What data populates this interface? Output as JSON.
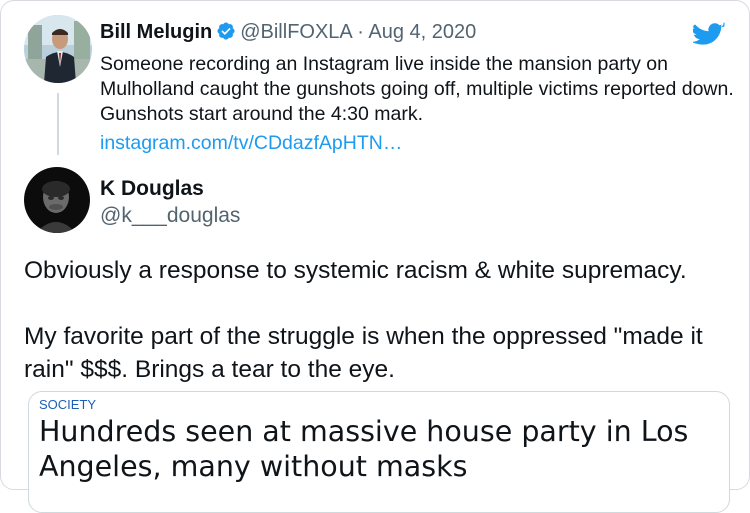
{
  "quoted_tweet": {
    "author_name": "Bill Melugin",
    "handle": "@BillFOXLA",
    "separator": "·",
    "date": "Aug 4, 2020",
    "text": "Someone recording an Instagram live inside the mansion party on Mulholland caught the gunshots going off, multiple victims reported down. Gunshots start around the 4:30 mark.",
    "link": "instagram.com/tv/CDdazfApHTN…",
    "verified_icon": "verified-badge-icon",
    "platform_icon": "twitter-bird-icon"
  },
  "reply": {
    "author_name": "K Douglas",
    "handle": "@k___douglas",
    "text_paragraph_1": "Obviously a response to systemic racism & white supremacy.",
    "text_paragraph_2": "My favorite part of the struggle is when the oppressed \"made it rain\" $$$. Brings a tear to the eye."
  },
  "link_card": {
    "category": "SOCIETY",
    "headline": "Hundreds seen at massive house party in Los Angeles, many without masks"
  },
  "colors": {
    "link_blue": "#1d9bf0",
    "secondary_text": "#536471",
    "border": "#cfd9de"
  }
}
